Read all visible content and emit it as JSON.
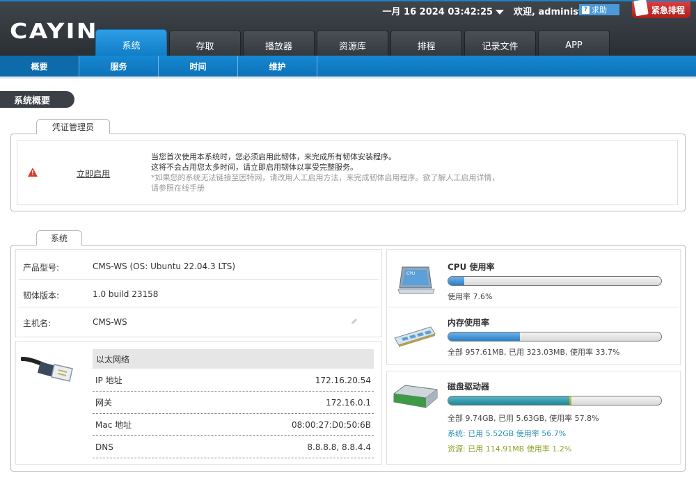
{
  "header": {
    "brand": "CAYIN",
    "datetime": "一月 16 2024 03:42:25",
    "welcome": "欢迎, administrator",
    "help": "求助",
    "urgent": "紧急排程"
  },
  "tabs": [
    {
      "label": "系统"
    },
    {
      "label": "存取"
    },
    {
      "label": "播放器"
    },
    {
      "label": "资源库"
    },
    {
      "label": "排程"
    },
    {
      "label": "记录文件"
    },
    {
      "label": "APP"
    }
  ],
  "subnav": [
    {
      "label": "概要"
    },
    {
      "label": "服务"
    },
    {
      "label": "时间"
    },
    {
      "label": "维护"
    }
  ],
  "page_title": "系统概要",
  "license": {
    "tab": "凭证管理员",
    "activate": "立即启用",
    "line1": "当您首次使用本系统时，您必须启用此韧体，来完成所有韧体安装程序。",
    "line2": "这将不会占用您太多时间，请立即启用韧体以享受完整服务。",
    "line3": "*如果您的系统无法链接至因特网，请改用人工启用方法，来完成韧体启用程序。欲了解人工启用详情，",
    "line4": "请参照在线手册"
  },
  "system": {
    "tab": "系统",
    "model_label": "产品型号:",
    "model_value": "CMS-WS (OS: Ubuntu 22.04.3 LTS)",
    "firmware_label": "韧体版本:",
    "firmware_value": "1.0 build 23158",
    "hostname_label": "主机名:",
    "hostname_value": "CMS-WS"
  },
  "network": {
    "title": "以太网络",
    "ip_label": "IP 地址",
    "ip_value": "172.16.20.54",
    "gateway_label": "网关",
    "gateway_value": "172.16.0.1",
    "mac_label": "Mac 地址",
    "mac_value": "08:00:27:D0:50:6B",
    "dns_label": "DNS",
    "dns_value": "8.8.8.8, 8.8.4.4"
  },
  "cpu": {
    "icon_label": "CPU",
    "title": "CPU 使用率",
    "usage": 7.6,
    "text": "使用率 7.6%"
  },
  "memory": {
    "title": "内存使用率",
    "usage": 33.7,
    "text": "全部 957.61MB, 已用 323.03MB, 使用率 33.7%"
  },
  "disk": {
    "title": "磁盘驱动器",
    "system_usage": 56.7,
    "resource_usage": 1.2,
    "total_text": "全部 9.74GB, 已用 5.63GB, 使用率 57.8%",
    "system_text": "系统: 已用 5.52GB 使用率 56.7%",
    "resource_text": "资源: 已用 114.91MB 使用率 1.2%"
  },
  "colors": {
    "accent": "#1588d3",
    "header": "#33383d",
    "warning": "#e03a2e",
    "urgent": "#c82828"
  }
}
